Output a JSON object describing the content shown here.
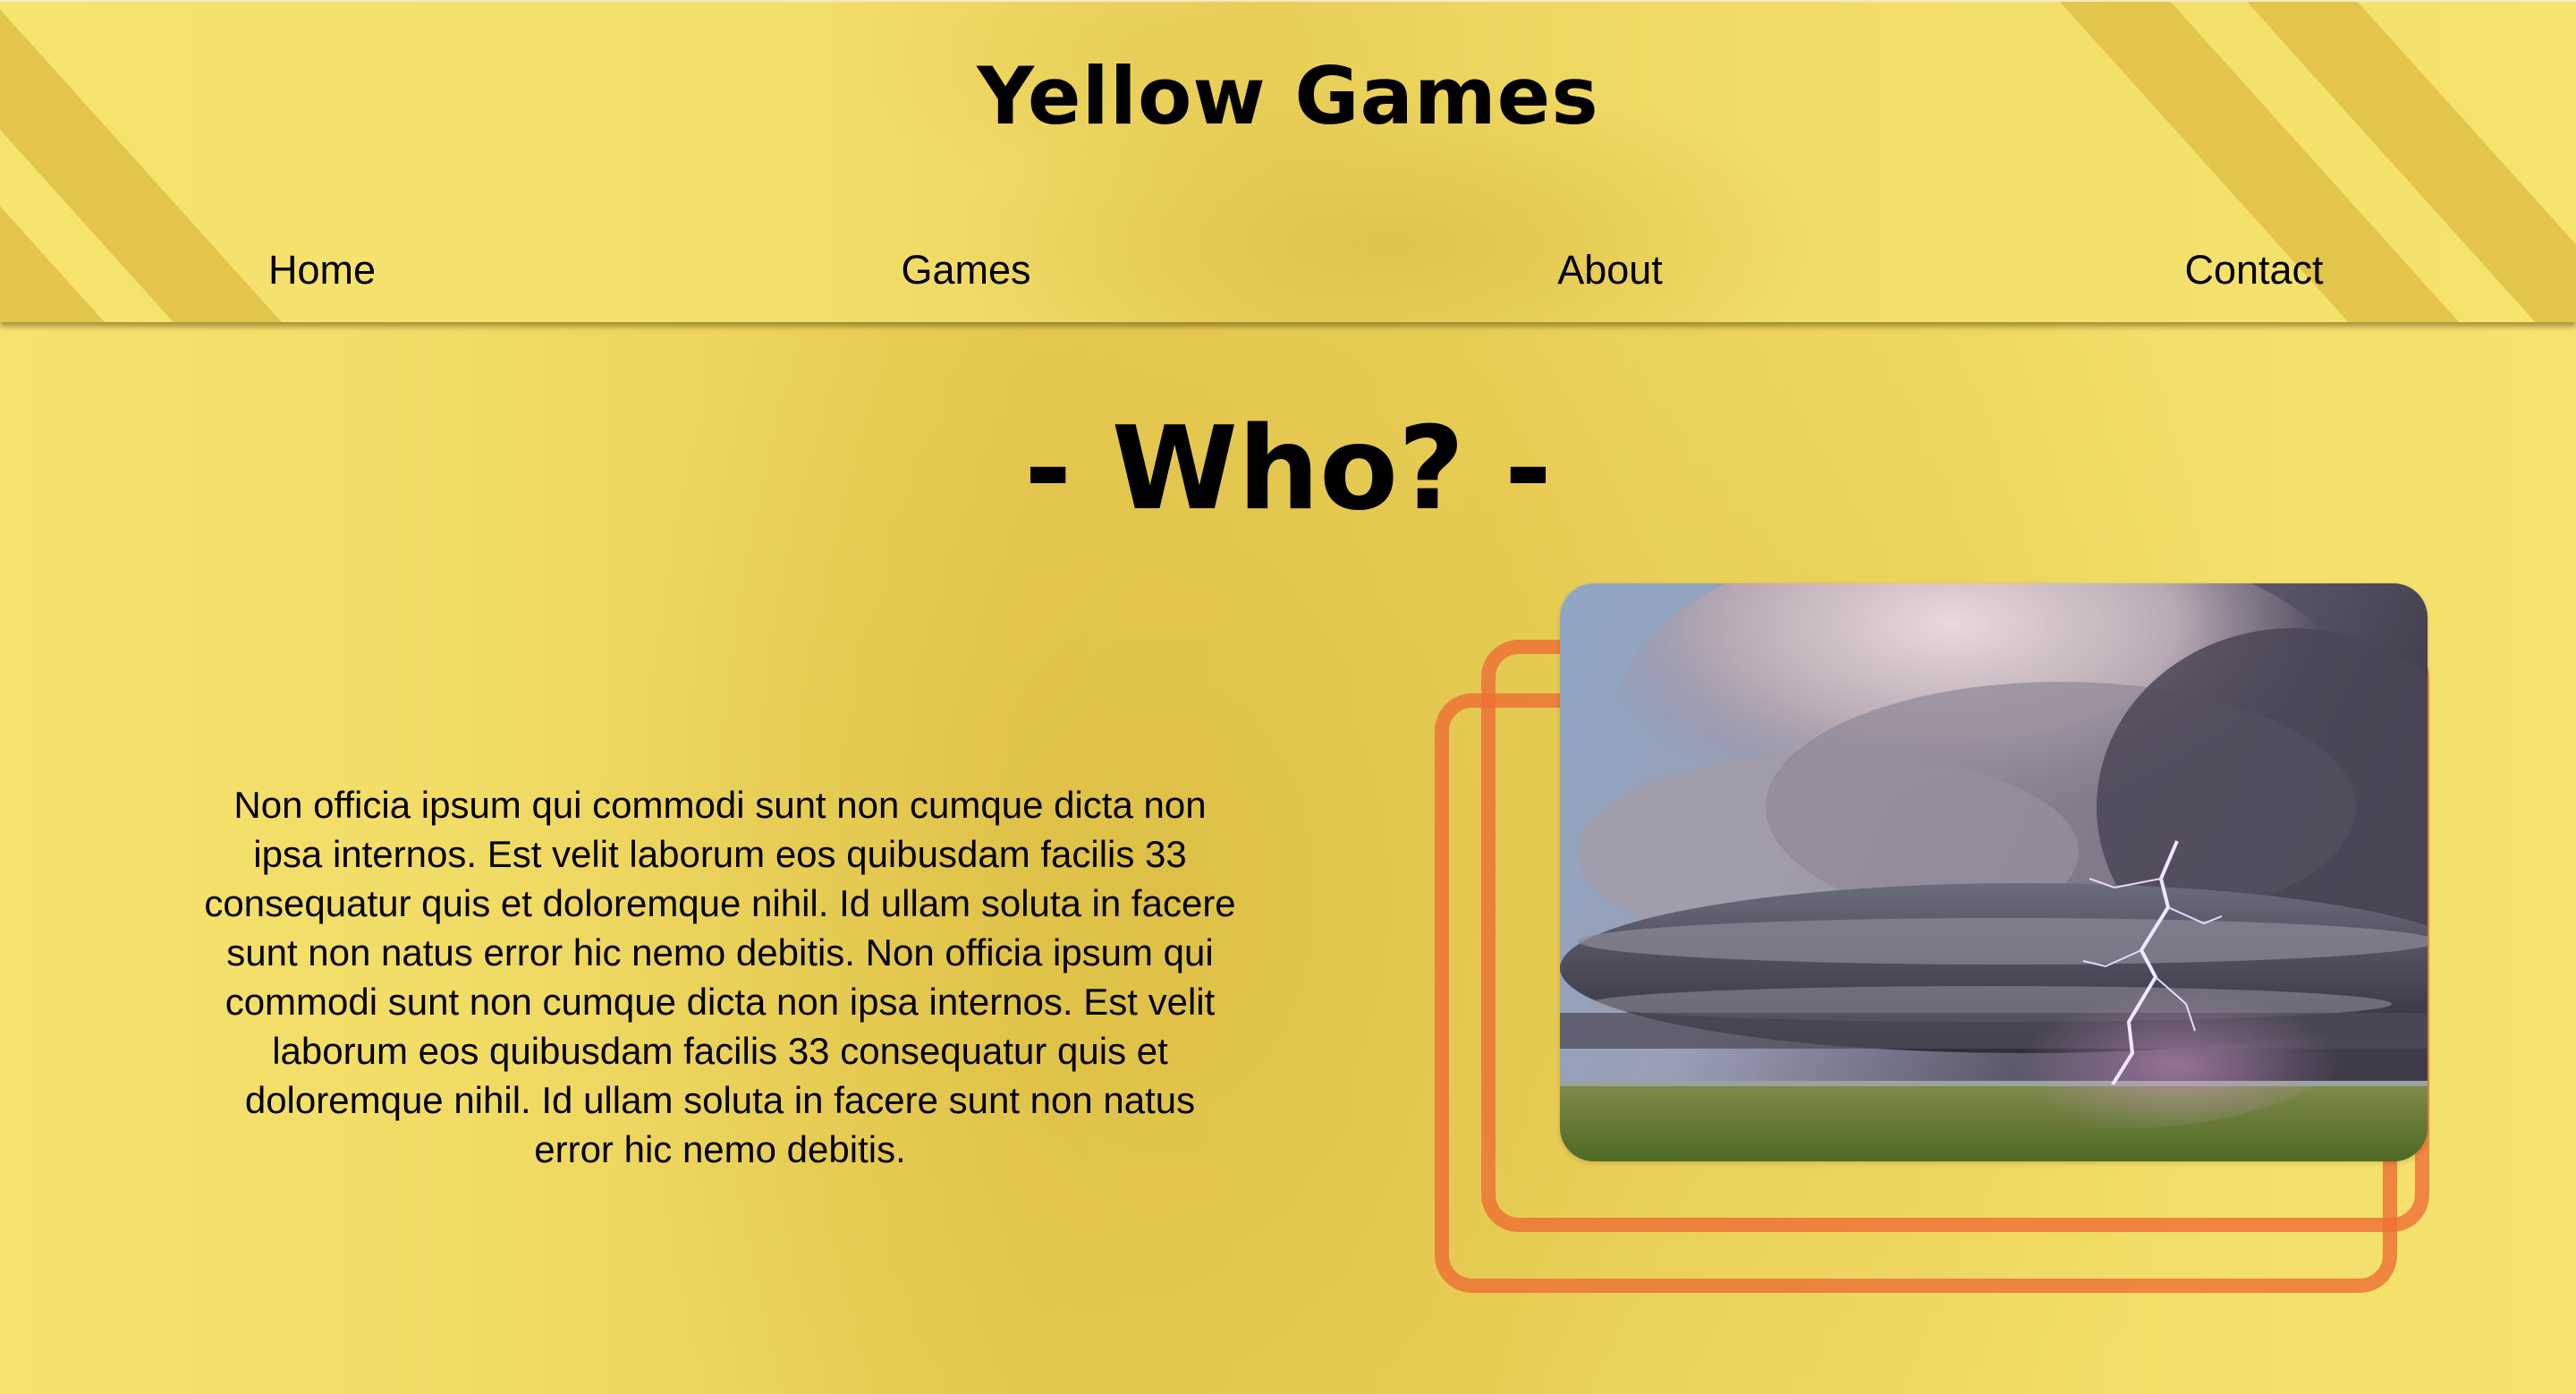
{
  "site": {
    "title": "Yellow Games"
  },
  "nav": {
    "items": [
      {
        "label": "Home"
      },
      {
        "label": "Games"
      },
      {
        "label": "About"
      },
      {
        "label": "Contact"
      }
    ]
  },
  "about": {
    "heading": "- Who? -",
    "body": "Non officia ipsum qui commodi sunt non cumque dicta non ipsa internos. Est velit laborum eos quibusdam facilis 33 consequatur quis et doloremque nihil. Id ullam soluta in facere sunt non natus error hic nemo debitis. Non officia ipsum qui commodi sunt non cumque dicta non ipsa internos. Est velit laborum eos quibusdam facilis 33 consequatur quis et doloremque nihil. Id ullam soluta in facere sunt non natus error hic nemo debitis."
  },
  "colors": {
    "background": "#ecd45e",
    "stripe": "#dfbf47",
    "frame": "#ee6e34",
    "text": "#000000"
  },
  "icons": {
    "photo": "storm-supercell-lightning-image"
  }
}
